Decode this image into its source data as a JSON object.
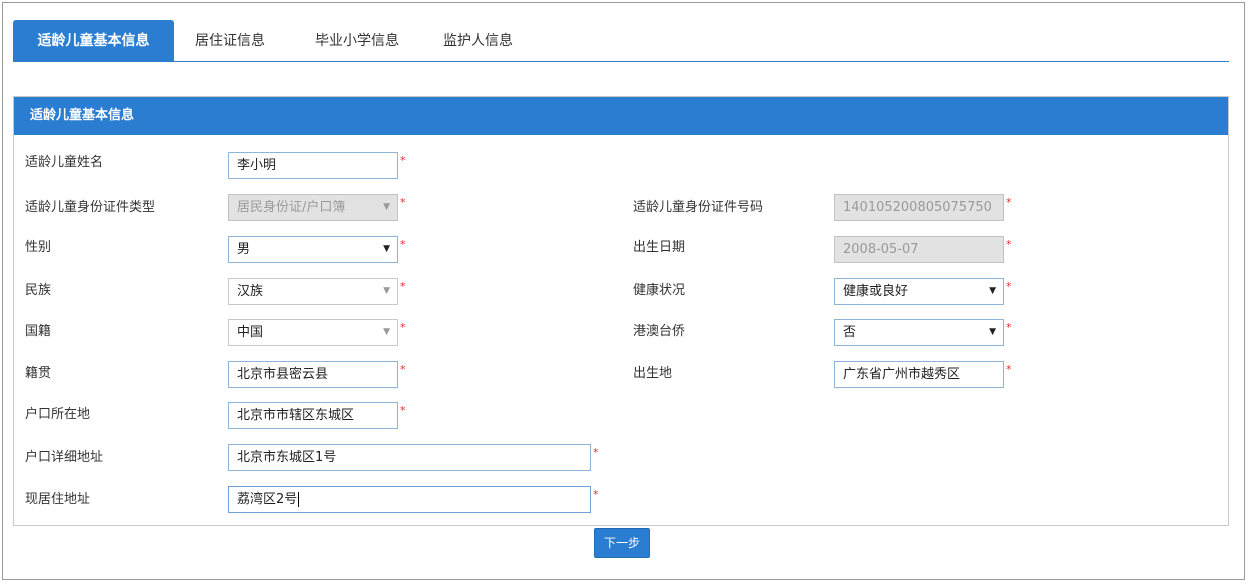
{
  "tabs": [
    {
      "label": "适龄儿童基本信息"
    },
    {
      "label": "居住证信息"
    },
    {
      "label": "毕业小学信息"
    },
    {
      "label": "监护人信息"
    }
  ],
  "panel": {
    "title": "适龄儿童基本信息"
  },
  "required_mark": "*",
  "form": {
    "name": {
      "label": "适龄儿童姓名",
      "value": "李小明"
    },
    "id_type": {
      "label": "适龄儿童身份证件类型",
      "value": "居民身份证/户口簿"
    },
    "id_number": {
      "label": "适龄儿童身份证件号码",
      "value": "140105200805075750"
    },
    "gender": {
      "label": "性别",
      "value": "男"
    },
    "birth_date": {
      "label": "出生日期",
      "value": "2008-05-07"
    },
    "ethnicity": {
      "label": "民族",
      "value": "汉族"
    },
    "health": {
      "label": "健康状况",
      "value": "健康或良好"
    },
    "nationality": {
      "label": "国籍",
      "value": "中国"
    },
    "overseas_chinese": {
      "label": "港澳台侨",
      "value": "否"
    },
    "native_place": {
      "label": "籍贯",
      "value": "北京市县密云县"
    },
    "birth_place": {
      "label": "出生地",
      "value": "广东省广州市越秀区"
    },
    "hukou_location": {
      "label": "户口所在地",
      "value": "北京市市辖区东城区"
    },
    "hukou_address": {
      "label": "户口详细地址",
      "value": "北京市东城区1号"
    },
    "current_address": {
      "label": "现居住地址",
      "value": "荔湾区2号"
    }
  },
  "next_button": {
    "label": "下一步"
  },
  "colors": {
    "primary": "#2a7dd1",
    "required": "#e03030"
  }
}
